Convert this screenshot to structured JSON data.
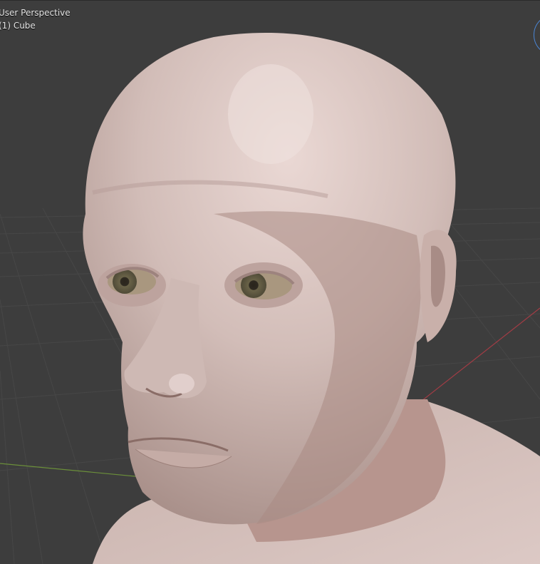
{
  "viewport": {
    "view_name": "User Perspective",
    "object_name": "(1) Cube"
  },
  "colors": {
    "background": "#3d3d3d",
    "grid": "#474747",
    "x_axis": "#a23c45",
    "y_axis": "#6b8f3a",
    "skin": "#d7c4c0",
    "gizmo": "#4a86d6"
  },
  "icons": {
    "navigation_gizmo": "view-navigation-gizmo-icon"
  }
}
